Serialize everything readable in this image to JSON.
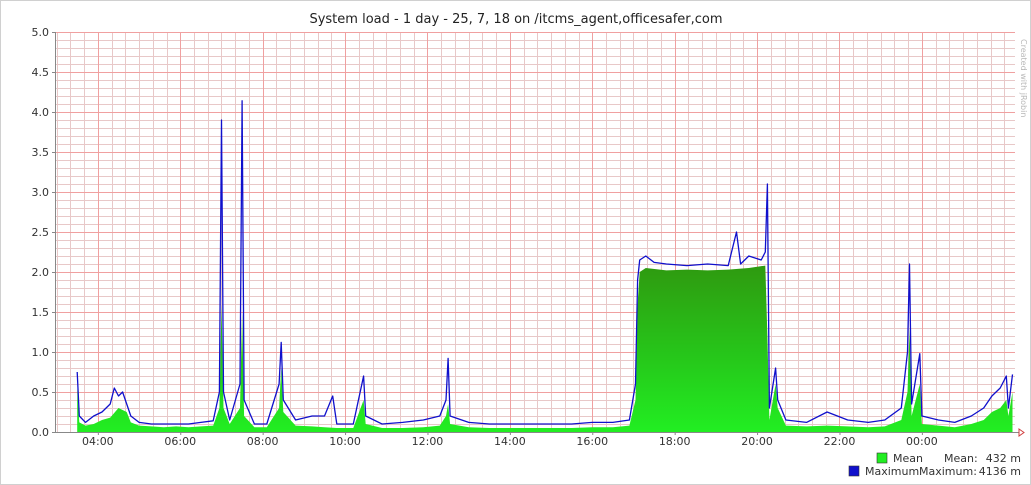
{
  "chart_data": {
    "type": "area",
    "title": "System load - 1 day - 25, 7, 18 on /itcms_agent,officesafer,com",
    "watermark": "Created with jRobin",
    "xlabel": "",
    "ylabel": "",
    "ylim": [
      0,
      5.0
    ],
    "xlim_hours": [
      2.96,
      26.26
    ],
    "y_ticks": [
      "0.0",
      "0.5",
      "1.0",
      "1.5",
      "2.0",
      "2.5",
      "3.0",
      "3.5",
      "4.0",
      "4.5",
      "5.0"
    ],
    "x_ticks": [
      {
        "label": "04:00",
        "hour": 4
      },
      {
        "label": "06:00",
        "hour": 6
      },
      {
        "label": "08:00",
        "hour": 8
      },
      {
        "label": "10:00",
        "hour": 10
      },
      {
        "label": "12:00",
        "hour": 12
      },
      {
        "label": "14:00",
        "hour": 14
      },
      {
        "label": "16:00",
        "hour": 16
      },
      {
        "label": "18:00",
        "hour": 18
      },
      {
        "label": "20:00",
        "hour": 20
      },
      {
        "label": "22:00",
        "hour": 22
      },
      {
        "label": "00:00",
        "hour": 24
      }
    ],
    "grid": true,
    "legend_position": "bottom-right",
    "colors": {
      "mean": "#22ee22",
      "mean_dark": "#2f9a10",
      "maximum": "#1010cc",
      "major_grid": "#f0a0a0",
      "minor_grid": "#e8c8c8",
      "axis": "#888888",
      "arrow": "#d04040"
    },
    "series": [
      {
        "name": "Mean",
        "summary_label": "Mean:",
        "summary_value": "432 m",
        "points": [
          [
            3.5,
            0.55
          ],
          [
            3.55,
            0.12
          ],
          [
            3.7,
            0.08
          ],
          [
            3.9,
            0.1
          ],
          [
            4.1,
            0.15
          ],
          [
            4.3,
            0.18
          ],
          [
            4.5,
            0.3
          ],
          [
            4.7,
            0.25
          ],
          [
            4.8,
            0.12
          ],
          [
            5.0,
            0.08
          ],
          [
            5.3,
            0.07
          ],
          [
            5.6,
            0.06
          ],
          [
            5.9,
            0.07
          ],
          [
            6.2,
            0.06
          ],
          [
            6.5,
            0.07
          ],
          [
            6.8,
            0.08
          ],
          [
            6.95,
            0.3
          ],
          [
            7.0,
            1.6
          ],
          [
            7.05,
            0.3
          ],
          [
            7.2,
            0.1
          ],
          [
            7.45,
            0.3
          ],
          [
            7.5,
            1.5
          ],
          [
            7.55,
            0.2
          ],
          [
            7.8,
            0.06
          ],
          [
            8.1,
            0.06
          ],
          [
            8.4,
            0.3
          ],
          [
            8.45,
            0.8
          ],
          [
            8.5,
            0.25
          ],
          [
            8.8,
            0.08
          ],
          [
            9.2,
            0.07
          ],
          [
            9.5,
            0.06
          ],
          [
            9.8,
            0.05
          ],
          [
            10.2,
            0.05
          ],
          [
            10.45,
            0.4
          ],
          [
            10.5,
            0.1
          ],
          [
            10.9,
            0.05
          ],
          [
            11.4,
            0.05
          ],
          [
            11.9,
            0.06
          ],
          [
            12.3,
            0.08
          ],
          [
            12.45,
            0.2
          ],
          [
            12.5,
            0.35
          ],
          [
            12.55,
            0.1
          ],
          [
            13.0,
            0.06
          ],
          [
            13.5,
            0.05
          ],
          [
            14.0,
            0.05
          ],
          [
            14.5,
            0.05
          ],
          [
            15.0,
            0.05
          ],
          [
            15.5,
            0.05
          ],
          [
            16.0,
            0.06
          ],
          [
            16.5,
            0.06
          ],
          [
            16.9,
            0.08
          ],
          [
            17.05,
            0.4
          ],
          [
            17.1,
            1.6
          ],
          [
            17.15,
            2.0
          ],
          [
            17.3,
            2.05
          ],
          [
            17.8,
            2.02
          ],
          [
            18.3,
            2.03
          ],
          [
            18.8,
            2.02
          ],
          [
            19.3,
            2.03
          ],
          [
            19.8,
            2.05
          ],
          [
            20.2,
            2.08
          ],
          [
            20.25,
            1.2
          ],
          [
            20.3,
            0.15
          ],
          [
            20.45,
            0.6
          ],
          [
            20.5,
            0.3
          ],
          [
            20.7,
            0.08
          ],
          [
            21.2,
            0.07
          ],
          [
            21.7,
            0.08
          ],
          [
            22.2,
            0.07
          ],
          [
            22.7,
            0.06
          ],
          [
            23.1,
            0.07
          ],
          [
            23.5,
            0.15
          ],
          [
            23.65,
            0.5
          ],
          [
            23.7,
            1.3
          ],
          [
            23.75,
            0.2
          ],
          [
            23.95,
            0.6
          ],
          [
            24.0,
            0.1
          ],
          [
            24.4,
            0.08
          ],
          [
            24.8,
            0.06
          ],
          [
            25.2,
            0.1
          ],
          [
            25.5,
            0.15
          ],
          [
            25.7,
            0.25
          ],
          [
            25.9,
            0.3
          ],
          [
            26.05,
            0.4
          ],
          [
            26.1,
            0.2
          ],
          [
            26.2,
            0.5
          ]
        ]
      },
      {
        "name": "Maximum",
        "summary_label": "Maximum:",
        "summary_value": "4136 m",
        "points": [
          [
            3.5,
            0.75
          ],
          [
            3.55,
            0.2
          ],
          [
            3.7,
            0.12
          ],
          [
            3.9,
            0.2
          ],
          [
            4.1,
            0.25
          ],
          [
            4.3,
            0.35
          ],
          [
            4.4,
            0.55
          ],
          [
            4.5,
            0.45
          ],
          [
            4.6,
            0.5
          ],
          [
            4.7,
            0.35
          ],
          [
            4.8,
            0.2
          ],
          [
            5.0,
            0.12
          ],
          [
            5.3,
            0.1
          ],
          [
            5.6,
            0.1
          ],
          [
            5.9,
            0.1
          ],
          [
            6.2,
            0.1
          ],
          [
            6.5,
            0.12
          ],
          [
            6.8,
            0.14
          ],
          [
            6.95,
            0.5
          ],
          [
            7.0,
            3.9
          ],
          [
            7.05,
            0.5
          ],
          [
            7.2,
            0.15
          ],
          [
            7.45,
            0.6
          ],
          [
            7.5,
            4.14
          ],
          [
            7.55,
            0.4
          ],
          [
            7.8,
            0.1
          ],
          [
            8.1,
            0.1
          ],
          [
            8.4,
            0.6
          ],
          [
            8.45,
            1.12
          ],
          [
            8.5,
            0.4
          ],
          [
            8.8,
            0.15
          ],
          [
            9.2,
            0.2
          ],
          [
            9.5,
            0.2
          ],
          [
            9.7,
            0.45
          ],
          [
            9.8,
            0.1
          ],
          [
            10.2,
            0.1
          ],
          [
            10.45,
            0.7
          ],
          [
            10.5,
            0.2
          ],
          [
            10.9,
            0.1
          ],
          [
            11.4,
            0.12
          ],
          [
            11.9,
            0.15
          ],
          [
            12.3,
            0.2
          ],
          [
            12.45,
            0.4
          ],
          [
            12.5,
            0.92
          ],
          [
            12.55,
            0.2
          ],
          [
            13.0,
            0.12
          ],
          [
            13.5,
            0.1
          ],
          [
            14.0,
            0.1
          ],
          [
            14.5,
            0.1
          ],
          [
            15.0,
            0.1
          ],
          [
            15.5,
            0.1
          ],
          [
            16.0,
            0.12
          ],
          [
            16.5,
            0.12
          ],
          [
            16.9,
            0.15
          ],
          [
            17.05,
            0.6
          ],
          [
            17.1,
            1.9
          ],
          [
            17.15,
            2.15
          ],
          [
            17.3,
            2.2
          ],
          [
            17.5,
            2.12
          ],
          [
            17.8,
            2.1
          ],
          [
            18.3,
            2.08
          ],
          [
            18.8,
            2.1
          ],
          [
            19.3,
            2.08
          ],
          [
            19.5,
            2.5
          ],
          [
            19.6,
            2.1
          ],
          [
            19.8,
            2.2
          ],
          [
            20.1,
            2.15
          ],
          [
            20.2,
            2.25
          ],
          [
            20.25,
            3.1
          ],
          [
            20.3,
            0.3
          ],
          [
            20.45,
            0.8
          ],
          [
            20.5,
            0.4
          ],
          [
            20.7,
            0.15
          ],
          [
            21.2,
            0.12
          ],
          [
            21.7,
            0.25
          ],
          [
            22.2,
            0.15
          ],
          [
            22.7,
            0.12
          ],
          [
            23.1,
            0.15
          ],
          [
            23.5,
            0.3
          ],
          [
            23.65,
            1.0
          ],
          [
            23.7,
            2.1
          ],
          [
            23.75,
            0.35
          ],
          [
            23.95,
            0.98
          ],
          [
            24.0,
            0.2
          ],
          [
            24.4,
            0.15
          ],
          [
            24.8,
            0.12
          ],
          [
            25.2,
            0.2
          ],
          [
            25.5,
            0.3
          ],
          [
            25.7,
            0.45
          ],
          [
            25.9,
            0.55
          ],
          [
            26.0,
            0.65
          ],
          [
            26.05,
            0.7
          ],
          [
            26.1,
            0.3
          ],
          [
            26.2,
            0.72
          ]
        ]
      }
    ]
  }
}
